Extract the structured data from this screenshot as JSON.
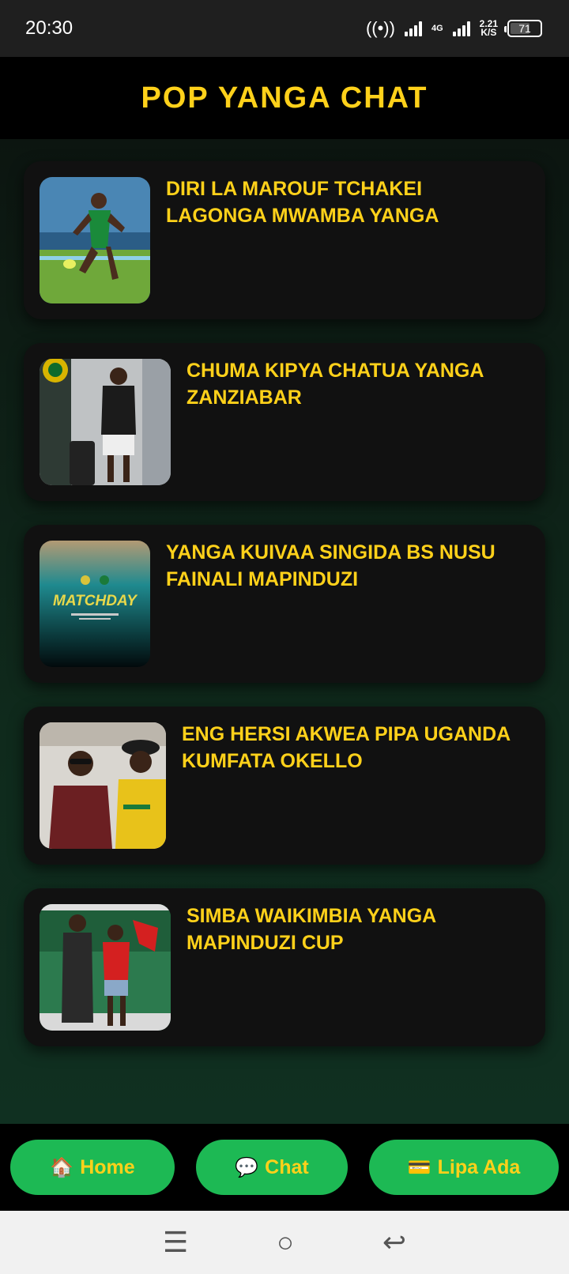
{
  "status": {
    "time": "20:30",
    "network": "4G",
    "speed_value": "2.21",
    "speed_unit": "K/S",
    "battery": "71"
  },
  "header": {
    "title": "POP YANGA CHAT"
  },
  "news": [
    {
      "title": "DIRI LA MAROUF TCHAKEI LAGONGA MWAMBA YANGA",
      "thumb": "football-player-photo"
    },
    {
      "title": "CHUMA KIPYA CHATUA YANGA ZANZIABAR",
      "thumb": "player-arrival-photo"
    },
    {
      "title": "YANGA KUIVAA SINGIDA BS NUSU FAINALI MAPINDUZI",
      "thumb": "matchday-poster",
      "thumb_text": "MATCHDAY"
    },
    {
      "title": "ENG HERSI AKWEA PIPA UGANDA KUMFATA OKELLO",
      "thumb": "airplane-photo"
    },
    {
      "title": "SIMBA WAIKIMBIA YANGA MAPINDUZI CUP",
      "thumb": "fans-photo"
    }
  ],
  "bottom_nav": {
    "home": {
      "icon": "🏠",
      "label": "Home"
    },
    "chat": {
      "icon": "💬",
      "label": "Chat"
    },
    "pay": {
      "icon": "💳",
      "label": "Lipa Ada"
    }
  },
  "colors": {
    "accent": "#ffd11a",
    "button": "#1db954",
    "card": "#111111"
  }
}
